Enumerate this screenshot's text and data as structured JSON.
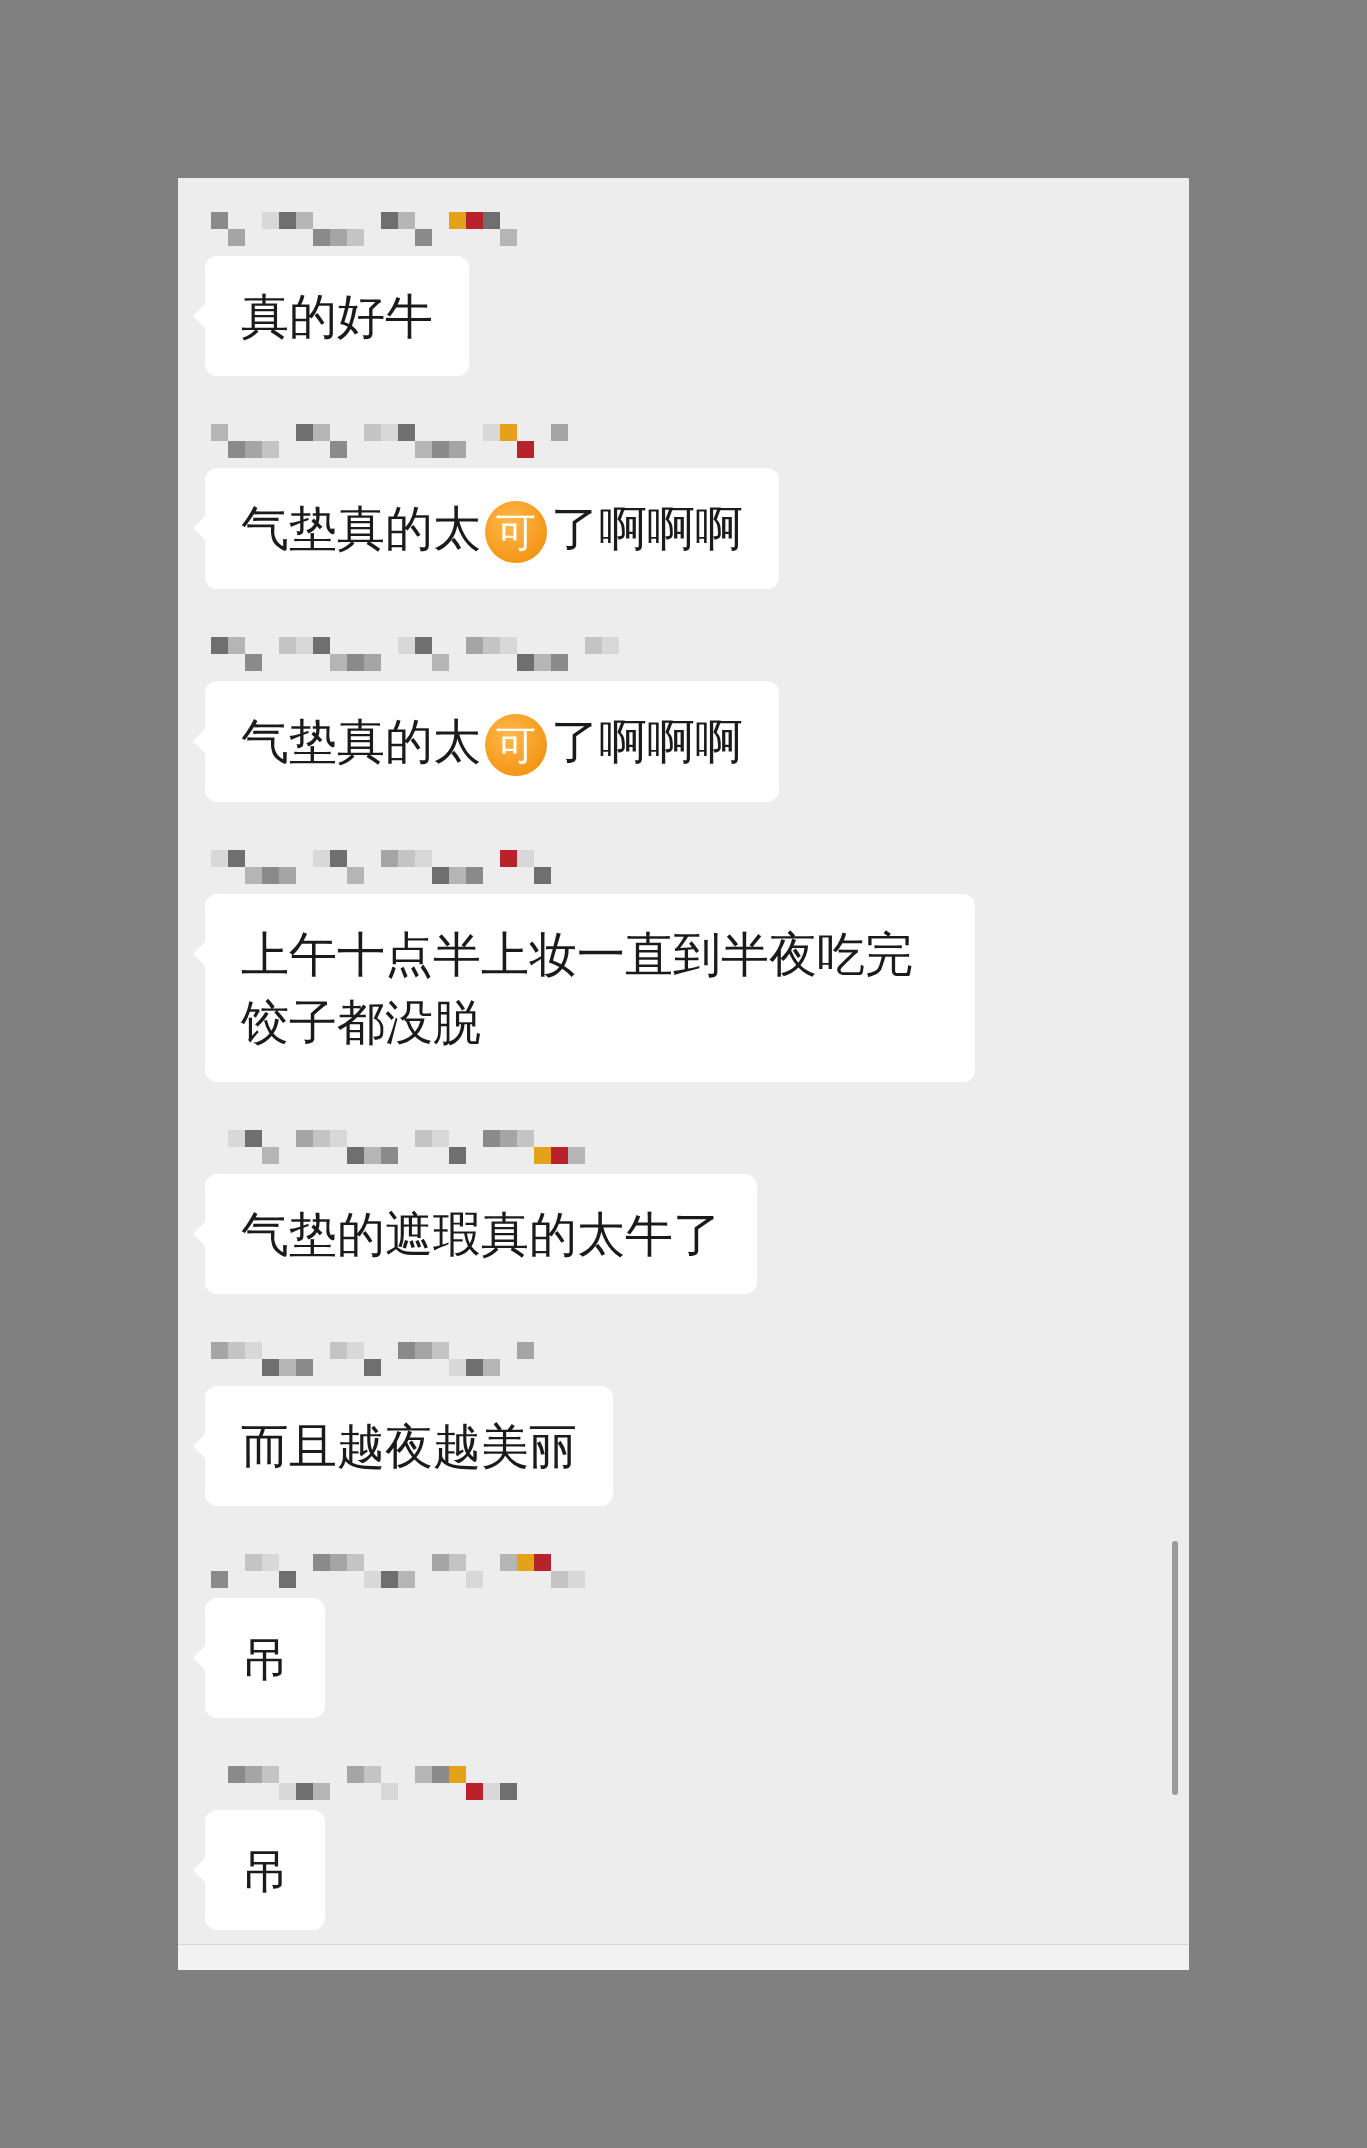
{
  "messages": [
    {
      "sender_hidden": true,
      "parts": [
        {
          "kind": "text",
          "text": "真的好牛"
        }
      ]
    },
    {
      "sender_hidden": true,
      "parts": [
        {
          "kind": "text",
          "text": "气垫真的太"
        },
        {
          "kind": "emoji",
          "text": "可"
        },
        {
          "kind": "text",
          "text": "了啊啊啊"
        }
      ]
    },
    {
      "sender_hidden": true,
      "parts": [
        {
          "kind": "text",
          "text": "气垫真的太"
        },
        {
          "kind": "emoji",
          "text": "可"
        },
        {
          "kind": "text",
          "text": "了啊啊啊"
        }
      ]
    },
    {
      "sender_hidden": true,
      "parts": [
        {
          "kind": "text",
          "text": "上午十点半上妆一直到半夜吃完饺子都没脱"
        }
      ]
    },
    {
      "sender_hidden": true,
      "parts": [
        {
          "kind": "text",
          "text": "气垫的遮瑕真的太牛了"
        }
      ]
    },
    {
      "sender_hidden": true,
      "parts": [
        {
          "kind": "text",
          "text": "而且越夜越美丽"
        }
      ]
    },
    {
      "sender_hidden": true,
      "parts": [
        {
          "kind": "text",
          "text": "吊"
        }
      ]
    },
    {
      "sender_hidden": true,
      "parts": [
        {
          "kind": "text",
          "text": "吊"
        }
      ]
    }
  ]
}
